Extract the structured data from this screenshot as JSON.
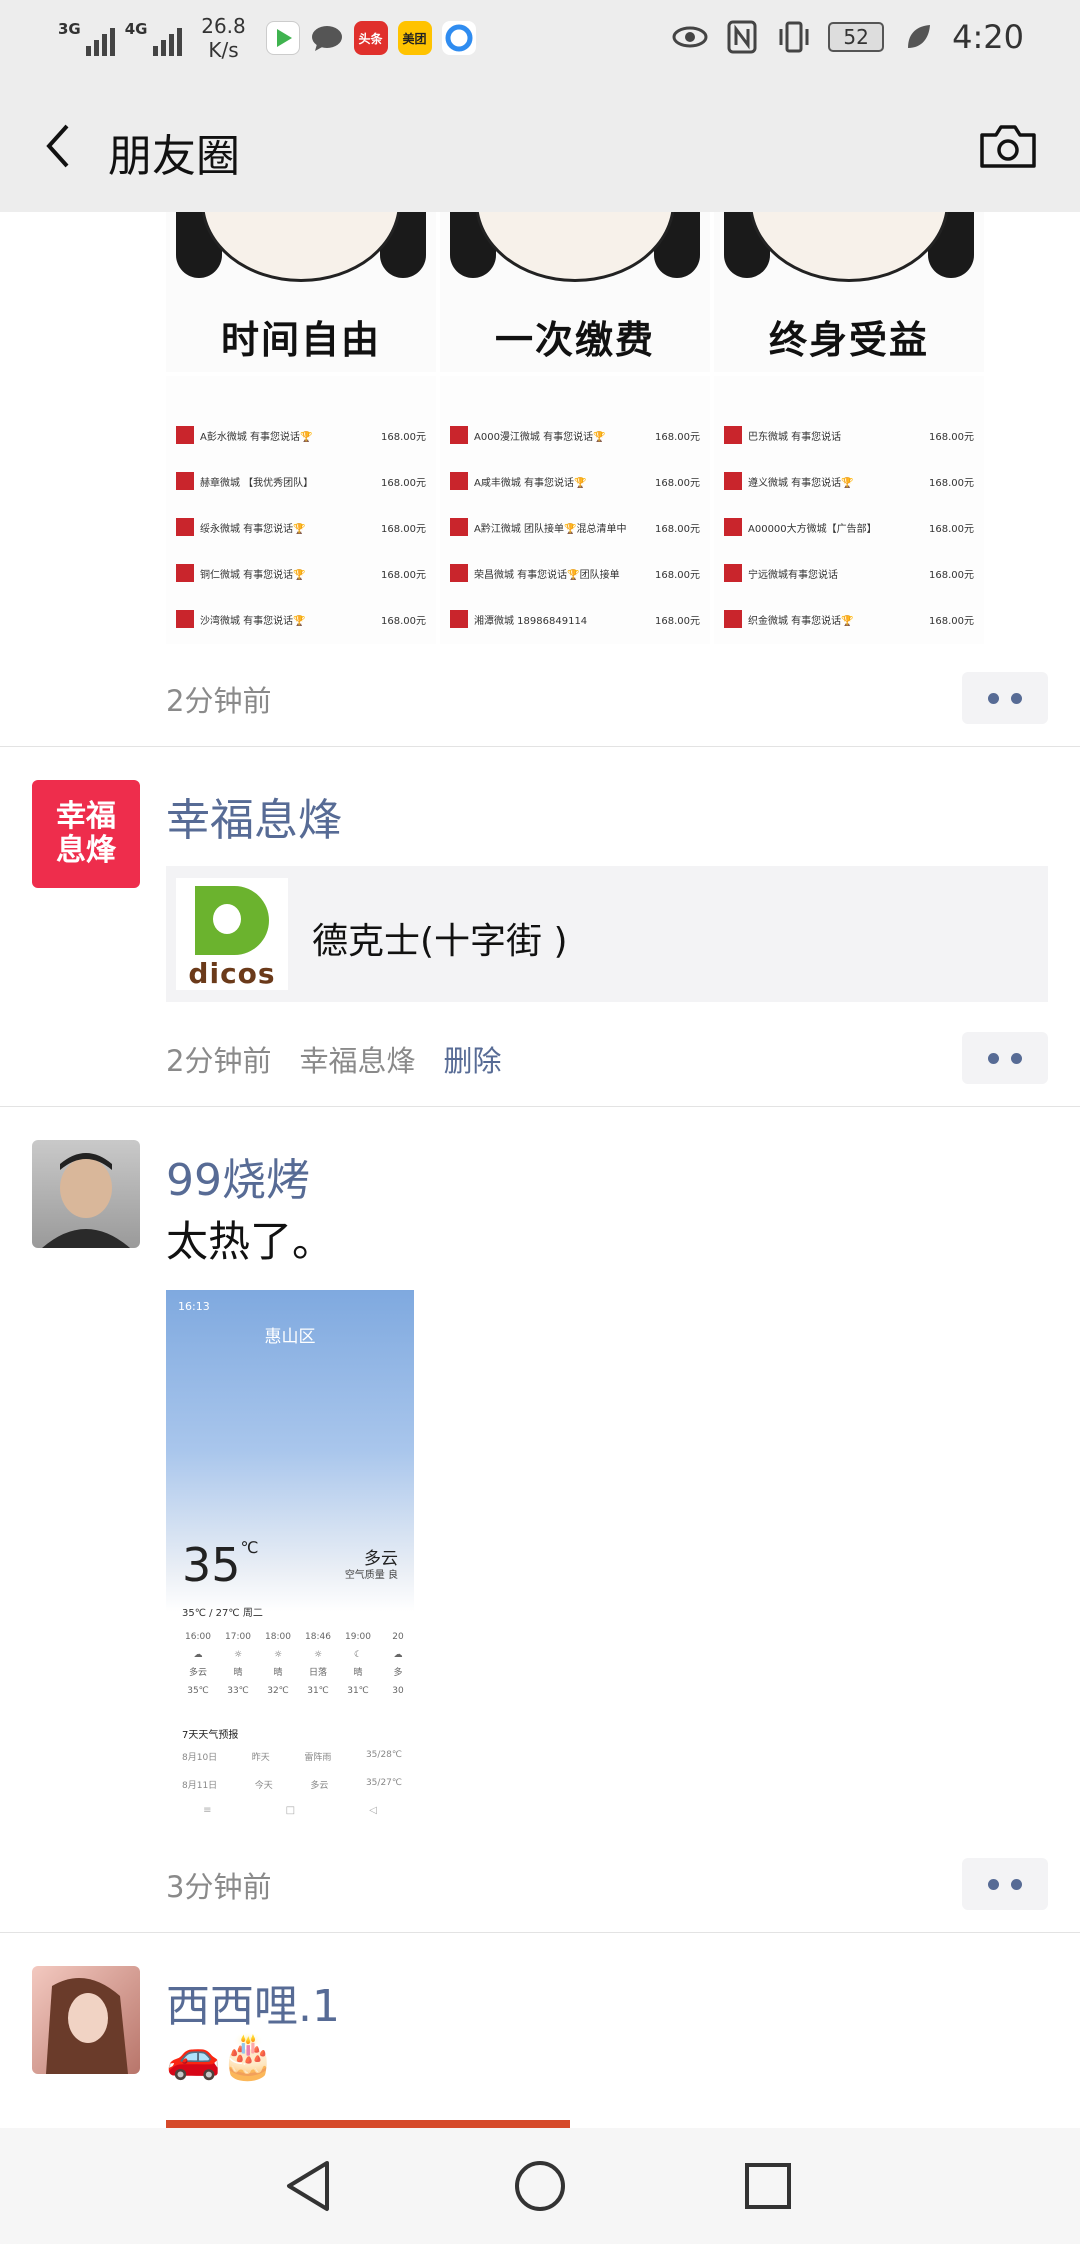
{
  "status_bar": {
    "network_1": "3G",
    "network_2": "4G",
    "speed_value": "26.8",
    "speed_unit": "K/s",
    "app_toutiao": "头条",
    "app_meituan": "美团",
    "battery": "52",
    "time": "4:20"
  },
  "header": {
    "title": "朋友圈"
  },
  "post1": {
    "captions": [
      "时间自由",
      "一次缴费",
      "终身受益"
    ],
    "list_columns": [
      [
        {
          "title": "A彭水微城 有事您说话🏆",
          "price": "168.00元"
        },
        {
          "title": "赫章微城 【我优秀团队】",
          "price": "168.00元"
        },
        {
          "title": "绥永微城 有事您说话🏆",
          "price": "168.00元"
        },
        {
          "title": "铜仁微城 有事您说话🏆",
          "price": "168.00元"
        },
        {
          "title": "沙湾微城 有事您说话🏆",
          "price": "168.00元"
        }
      ],
      [
        {
          "title": "A000漫江微城 有事您说话🏆",
          "price": "168.00元"
        },
        {
          "title": "A咸丰微城 有事您说话🏆",
          "price": "168.00元"
        },
        {
          "title": "A黔江微城 团队接单🏆混总清单中",
          "price": "168.00元"
        },
        {
          "title": "荣昌微城 有事您说话🏆团队接单",
          "price": "168.00元"
        },
        {
          "title": "湘潭微城 18986849114",
          "price": "168.00元"
        }
      ],
      [
        {
          "title": "巴东微城 有事您说话",
          "price": "168.00元"
        },
        {
          "title": "遵义微城 有事您说话🏆",
          "price": "168.00元"
        },
        {
          "title": "A00000大方微城【广告部】",
          "price": "168.00元"
        },
        {
          "title": "宁远微城有事您说话",
          "price": "168.00元"
        },
        {
          "title": "织金微城 有事您说话🏆",
          "price": "168.00元"
        }
      ]
    ],
    "time": "2分钟前"
  },
  "post2": {
    "avatar_text": "幸福息烽",
    "name": "幸福息烽",
    "link_logo": "dicos",
    "link_title": "德克士(十字街 )",
    "time": "2分钟前",
    "source": "幸福息烽",
    "delete_label": "删除"
  },
  "post3": {
    "name": "99烧烤",
    "text": "太热了。",
    "weather": {
      "status_time": "16:13",
      "city": "惠山区",
      "temp": "35",
      "temp_unit": "℃",
      "condition": "多云",
      "air": "空气质量 良",
      "range": "35℃ / 27℃   周二",
      "hours": [
        "16:00",
        "17:00",
        "18:00",
        "18:46",
        "19:00",
        "20"
      ],
      "hour_cond": [
        "多云",
        "晴",
        "晴",
        "日落",
        "晴",
        "多"
      ],
      "hour_temp": [
        "35℃",
        "33℃",
        "32℃",
        "31℃",
        "31℃",
        "30"
      ],
      "forecast_title": "7天天气预报",
      "forecast": [
        {
          "date": "8月10日",
          "day": "昨天",
          "cond": "雷阵雨",
          "range": "35/28℃"
        },
        {
          "date": "8月11日",
          "day": "今天",
          "cond": "多云",
          "range": "35/27℃"
        }
      ]
    },
    "time": "3分钟前"
  },
  "post4": {
    "name": "西西哩.1",
    "emojis": "🚗🎂"
  },
  "colors": {
    "link_blue": "#576b95",
    "header_bg": "#ededed",
    "meta_gray": "#8a8a8a"
  },
  "icons": {
    "back": "back-arrow-icon",
    "camera": "camera-icon",
    "more": "more-dots-icon",
    "nav": [
      "nav-back-icon",
      "nav-home-icon",
      "nav-recent-icon"
    ]
  }
}
